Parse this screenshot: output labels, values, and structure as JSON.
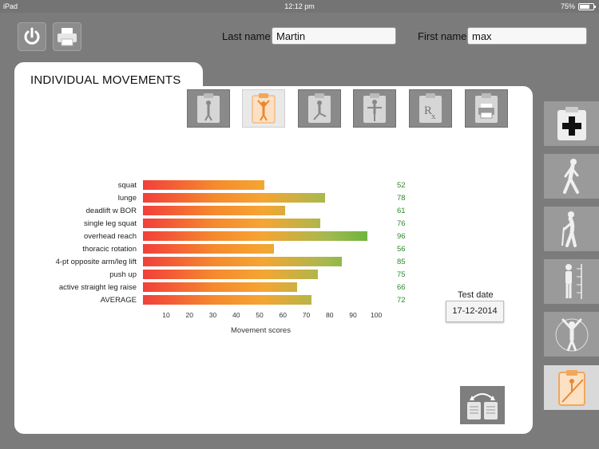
{
  "status_bar": {
    "device": "iPad",
    "time": "12:12 pm",
    "battery": "75%"
  },
  "header": {
    "last_name_label": "Last name",
    "last_name_value": "Martin",
    "first_name_label": "First name",
    "first_name_value": "max"
  },
  "panel": {
    "tab_title": "INDIVIDUAL MOVEMENTS"
  },
  "category_icons": [
    "clipboard-figure-icon",
    "clipboard-overhead-reach-icon",
    "clipboard-lunge-icon",
    "clipboard-single-leg-icon",
    "clipboard-rx-icon",
    "clipboard-printer-icon"
  ],
  "sidebar_icons": [
    "medical-kit-icon",
    "walking-person-icon",
    "elderly-cane-icon",
    "posture-measure-icon",
    "overhead-figure-icon",
    "clipboard-active-icon"
  ],
  "chart_data": {
    "type": "bar",
    "orientation": "horizontal",
    "categories": [
      "squat",
      "lunge",
      "deadlift w BOR",
      "single leg squat",
      "overhead reach",
      "thoracic rotation",
      "4-pt opposite arm/leg lift",
      "push up",
      "active straight leg raise",
      "AVERAGE"
    ],
    "values": [
      52,
      78,
      61,
      76,
      96,
      56,
      85,
      75,
      66,
      72
    ],
    "score_labels": [
      "52",
      "78",
      "61",
      "76",
      "96",
      "56",
      "85",
      "75",
      "66",
      "72"
    ],
    "x_ticks": [
      "10",
      "20",
      "30",
      "40",
      "50",
      "60",
      "70",
      "80",
      "90",
      "100"
    ],
    "xlabel": "Movement scores",
    "xlim": [
      0,
      100
    ],
    "score_color": "#2d8a2d",
    "gradient": [
      "#f23f3a",
      "#f5a532",
      "#68b53c"
    ]
  },
  "test_date": {
    "label": "Test date",
    "value": "17-12-2014"
  }
}
